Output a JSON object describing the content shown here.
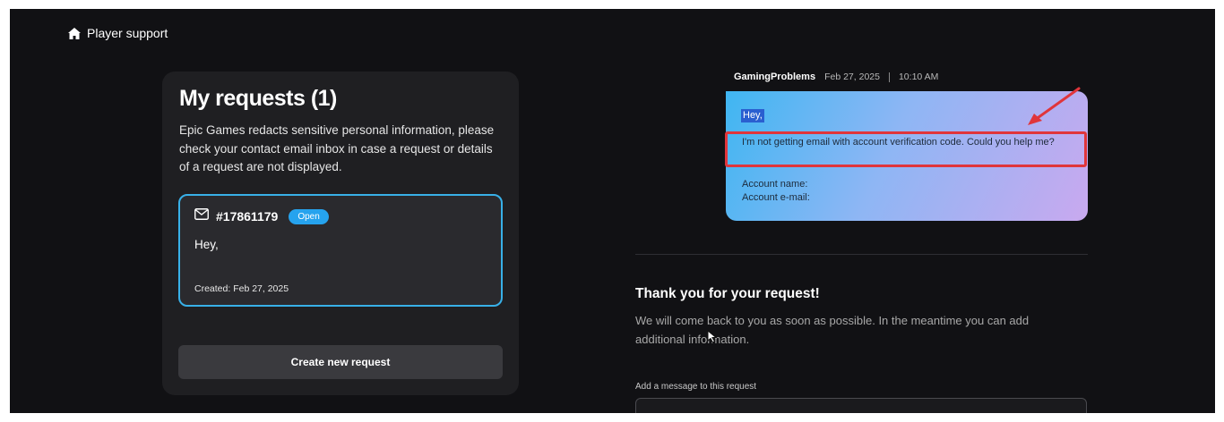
{
  "header": {
    "title": "Player support",
    "icon": "home-icon"
  },
  "requests": {
    "title": "My requests (1)",
    "notice": "Epic Games redacts sensitive personal information, please check your contact email inbox in case a request or details of a request are not displayed.",
    "items": [
      {
        "id": "#17861179",
        "status": "Open",
        "preview": "Hey,",
        "created": "Created: Feb 27, 2025",
        "icon": "mail-icon"
      }
    ],
    "create_button": "Create new request"
  },
  "conversation": {
    "author": "GamingProblems",
    "date": "Feb 27, 2025",
    "time": "10:10 AM",
    "message": {
      "greeting": "Hey,",
      "body": "I'm not getting email with account verification code. Could you help me?",
      "account_name_label": "Account name:",
      "account_email_label": "Account e-mail:"
    }
  },
  "reply": {
    "thanks_title": "Thank you for your request!",
    "thanks_text": "We will come back to you as soon as possible. In the meantime you can add additional information.",
    "add_label": "Add a message to this request",
    "input_value": ""
  },
  "colors": {
    "accent": "#38b0e8",
    "badge": "#26a3ee",
    "annotation": "#e0353b",
    "background": "#111114"
  }
}
